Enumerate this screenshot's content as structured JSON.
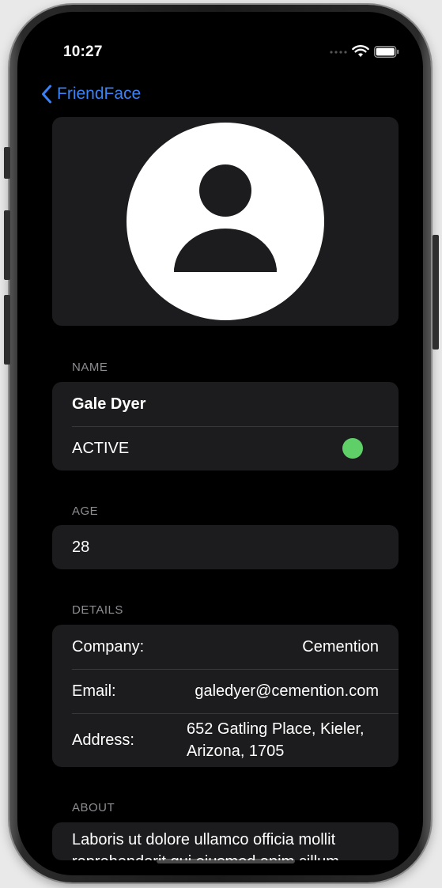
{
  "status_bar": {
    "time": "10:27"
  },
  "nav": {
    "back_label": "FriendFace"
  },
  "sections": {
    "name_header": "NAME",
    "age_header": "AGE",
    "details_header": "DETAILS",
    "about_header": "ABOUT"
  },
  "profile": {
    "name": "Gale Dyer",
    "status_label": "ACTIVE",
    "status_color": "#5fd068",
    "age": "28"
  },
  "details": {
    "company_label": "Company:",
    "company_value": "Cemention",
    "email_label": "Email:",
    "email_value": "galedyer@cemention.com",
    "address_label": "Address:",
    "address_value": "652 Gatling Place, Kieler, Arizona, 1705"
  },
  "about": {
    "text": "Laboris ut dolore ullamco officia mollit reprehenderit qui eiusmod anim cillum"
  },
  "colors": {
    "accent": "#3b82f6",
    "card_background": "#1c1c1e",
    "screen_background": "#000000",
    "secondary_label": "#8d8d92"
  },
  "icons": {
    "back": "chevron-left-icon",
    "avatar": "person-placeholder-icon",
    "signal": "cellular-signal-icon",
    "wifi": "wifi-icon",
    "battery": "battery-icon"
  }
}
